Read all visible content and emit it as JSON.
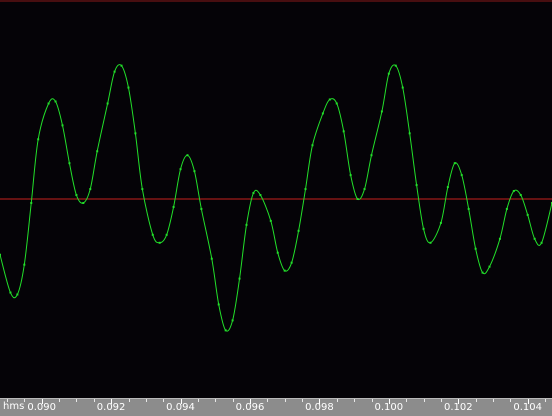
{
  "chart_data": {
    "type": "line",
    "title": "",
    "xlabel": "",
    "ylabel": "",
    "x_unit_label": "hms",
    "xlim": [
      0.0888,
      0.1047
    ],
    "ylim": [
      -1.0,
      1.0
    ],
    "grid": false,
    "x_ticks": [
      {
        "value": 0.09,
        "label": "0.090"
      },
      {
        "value": 0.092,
        "label": "0.092"
      },
      {
        "value": 0.094,
        "label": "0.094"
      },
      {
        "value": 0.096,
        "label": "0.096"
      },
      {
        "value": 0.098,
        "label": "0.098"
      },
      {
        "value": 0.1,
        "label": "0.100"
      },
      {
        "value": 0.102,
        "label": "0.102"
      },
      {
        "value": 0.104,
        "label": "0.104"
      }
    ],
    "minor_tick_step": 0.0005,
    "zero_line": {
      "y": 0.0,
      "color": "#c8201e"
    },
    "top_line_color": "#8a1a1a",
    "series": [
      {
        "color": "#22e02a",
        "points": [
          [
            0.0888,
            -0.28
          ],
          [
            0.0891,
            -0.47
          ],
          [
            0.0893,
            -0.48
          ],
          [
            0.0895,
            -0.33
          ],
          [
            0.0897,
            -0.02
          ],
          [
            0.0899,
            0.3
          ],
          [
            0.0902,
            0.48
          ],
          [
            0.0904,
            0.49
          ],
          [
            0.0906,
            0.37
          ],
          [
            0.0908,
            0.18
          ],
          [
            0.091,
            0.02
          ],
          [
            0.0912,
            -0.02
          ],
          [
            0.0914,
            0.05
          ],
          [
            0.0916,
            0.24
          ],
          [
            0.0919,
            0.48
          ],
          [
            0.0921,
            0.64
          ],
          [
            0.0923,
            0.67
          ],
          [
            0.0925,
            0.56
          ],
          [
            0.0927,
            0.33
          ],
          [
            0.0929,
            0.05
          ],
          [
            0.0932,
            -0.18
          ],
          [
            0.0934,
            -0.22
          ],
          [
            0.0936,
            -0.18
          ],
          [
            0.0938,
            -0.04
          ],
          [
            0.094,
            0.15
          ],
          [
            0.0942,
            0.22
          ],
          [
            0.0944,
            0.14
          ],
          [
            0.0946,
            -0.05
          ],
          [
            0.0949,
            -0.3
          ],
          [
            0.0951,
            -0.53
          ],
          [
            0.0953,
            -0.66
          ],
          [
            0.0955,
            -0.61
          ],
          [
            0.0957,
            -0.4
          ],
          [
            0.0959,
            -0.13
          ],
          [
            0.0961,
            0.03
          ],
          [
            0.0963,
            0.02
          ],
          [
            0.0966,
            -0.11
          ],
          [
            0.0968,
            -0.27
          ],
          [
            0.097,
            -0.36
          ],
          [
            0.0972,
            -0.32
          ],
          [
            0.0974,
            -0.16
          ],
          [
            0.0976,
            0.05
          ],
          [
            0.0978,
            0.27
          ],
          [
            0.0981,
            0.43
          ],
          [
            0.0983,
            0.5
          ],
          [
            0.0985,
            0.48
          ],
          [
            0.0987,
            0.34
          ],
          [
            0.0989,
            0.12
          ],
          [
            0.0991,
            0.0
          ],
          [
            0.0993,
            0.05
          ],
          [
            0.0995,
            0.22
          ],
          [
            0.0998,
            0.44
          ],
          [
            0.1,
            0.63
          ],
          [
            0.1002,
            0.67
          ],
          [
            0.1004,
            0.56
          ],
          [
            0.1006,
            0.33
          ],
          [
            0.1008,
            0.07
          ],
          [
            0.101,
            -0.15
          ],
          [
            0.1012,
            -0.22
          ],
          [
            0.1015,
            -0.12
          ],
          [
            0.1017,
            0.06
          ],
          [
            0.1019,
            0.18
          ],
          [
            0.1021,
            0.12
          ],
          [
            0.1023,
            -0.05
          ],
          [
            0.1025,
            -0.25
          ],
          [
            0.1027,
            -0.37
          ],
          [
            0.1029,
            -0.34
          ],
          [
            0.1032,
            -0.2
          ],
          [
            0.1034,
            -0.05
          ],
          [
            0.1036,
            0.04
          ],
          [
            0.1038,
            0.02
          ],
          [
            0.104,
            -0.08
          ],
          [
            0.1042,
            -0.2
          ],
          [
            0.1044,
            -0.22
          ],
          [
            0.1047,
            -0.02
          ]
        ]
      }
    ]
  }
}
